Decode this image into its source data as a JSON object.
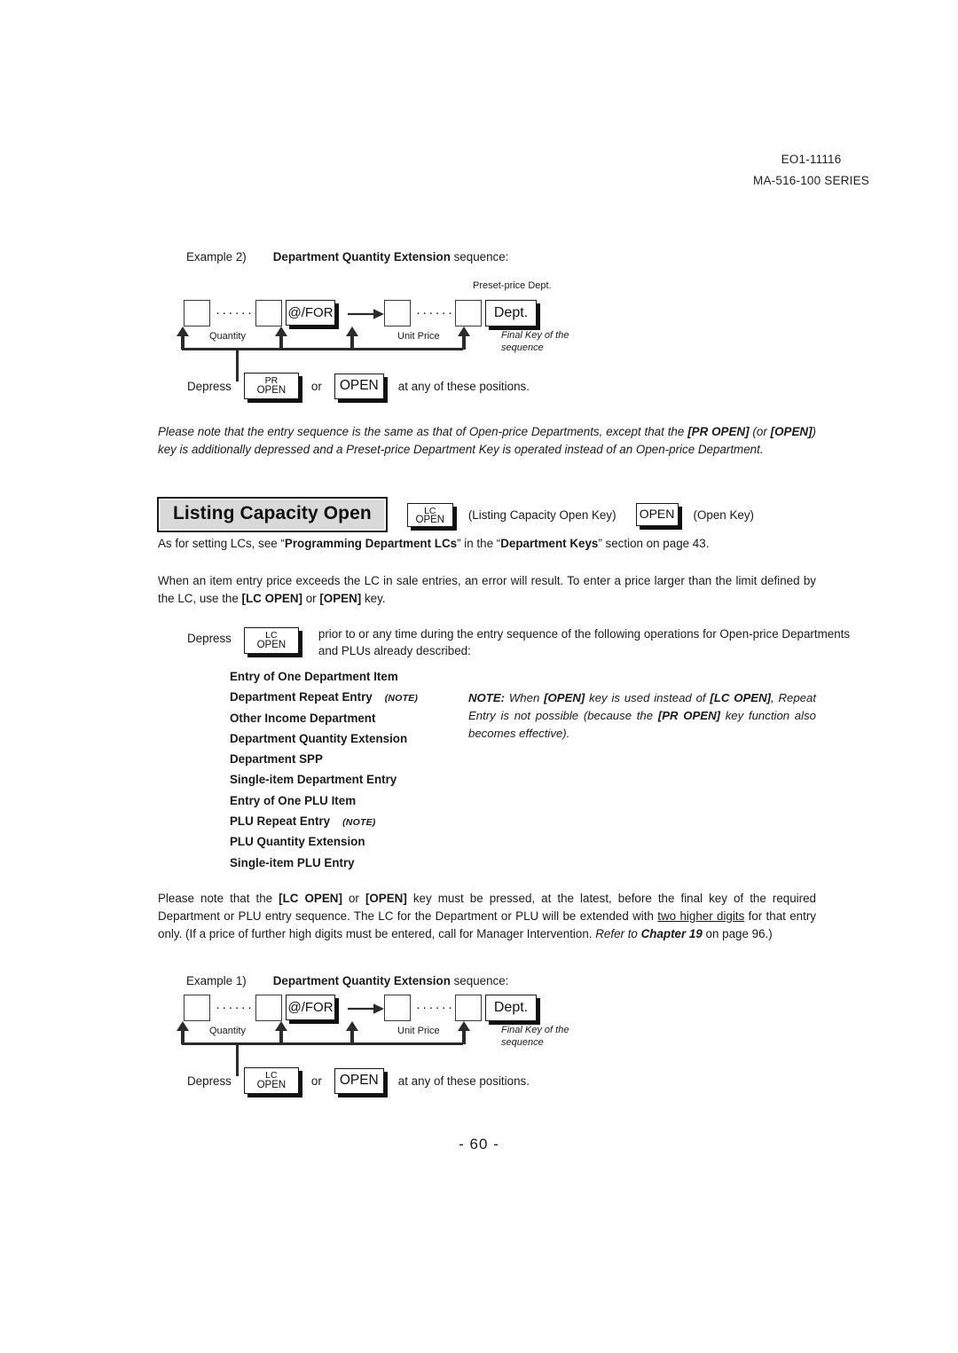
{
  "header": {
    "line1": "EO1-11116",
    "line2": "MA-516-100 SERIES"
  },
  "example2": {
    "label": "Example 2)",
    "title_bold": "Department Quantity Extension",
    "title_tail": " sequence:",
    "dots": "·······",
    "quantity_label": "Quantity",
    "unit_price_label": "Unit Price",
    "forfor_key": "@/FOR",
    "dept_key": "Dept.",
    "preset_label": "Preset-price Dept.",
    "final_key_line1": "Final Key of the",
    "final_key_line2": "sequence",
    "depress_word": "Depress",
    "key_pr_line1": "PR",
    "key_pr_line2": "OPEN",
    "or_word": "or",
    "key_open": "OPEN",
    "tail_text": "at any of these positions."
  },
  "note_paragraph": {
    "part1": "Please note that the entry sequence is the same as that of Open-price Departments, except that the ",
    "bold1": "[PR OPEN]",
    "part2": " (or ",
    "bold2": "[OPEN]",
    "part3": ") key is additionally depressed and a Preset-price Department Key is operated instead of an Open-price Department."
  },
  "section": {
    "heading": "Listing Capacity Open",
    "lc_key_line1": "LC",
    "lc_key_line2": "OPEN",
    "lc_caption": "(Listing Capacity Open Key)",
    "open_key": "OPEN",
    "open_caption": "(Open Key)"
  },
  "ref_line": {
    "part1": "As for setting LCs, see “",
    "bold1": "Programming Department LCs",
    "part2": "” in the “",
    "bold2": "Department Keys",
    "part3": "” section on page 43."
  },
  "lc_intro": {
    "part1": "When an item entry price exceeds the LC in sale entries, an error will result. To enter a price larger than the limit defined by the LC, use the ",
    "bold1": "[LC OPEN]",
    "part2": " or ",
    "bold2": "[OPEN]",
    "part3": " key."
  },
  "depress_lc": {
    "word": "Depress",
    "key_line1": "LC",
    "key_line2": "OPEN",
    "text_line1": "prior to or any time during the entry sequence of the following operations for Open-price",
    "text_line2": "Departments and PLUs already described:"
  },
  "operations": [
    {
      "label": "Entry of One Department Item",
      "note": ""
    },
    {
      "label": "Department Repeat Entry",
      "note": "(NOTE)"
    },
    {
      "label": "Other Income Department",
      "note": ""
    },
    {
      "label": "Department Quantity Extension",
      "note": ""
    },
    {
      "label": "Department SPP",
      "note": ""
    },
    {
      "label": "Single-item Department Entry",
      "note": ""
    },
    {
      "label": "Entry of One PLU Item",
      "note": ""
    },
    {
      "label": "PLU Repeat Entry",
      "note": "(NOTE)"
    },
    {
      "label": "PLU Quantity Extension",
      "note": ""
    },
    {
      "label": "Single-item PLU Entry",
      "note": ""
    }
  ],
  "note_box": {
    "lead": "NOTE:",
    "part1": " When ",
    "bold1": "[OPEN]",
    "part2": " key is used instead of ",
    "bold2": "[LC OPEN]",
    "part3": ", Repeat Entry is not possible (because the ",
    "bold3": "[PR OPEN]",
    "part4": " key function also becomes effective)."
  },
  "closing_paragraph": {
    "part1": "Please note that the ",
    "bold1": "[LC OPEN]",
    "part2": " or ",
    "bold2": "[OPEN]",
    "part3": " key must be pressed, at the latest, before the final key of the required Department or PLU entry sequence. The LC for the Department or PLU will be extended with ",
    "underline1": "two higher digits",
    "part4": " for that entry only. (If a price of further high digits must be entered, call for Manager Intervention. ",
    "italic1": "Refer to ",
    "italicbold1": "Chapter 19",
    "part5": " on page 96.)"
  },
  "example1": {
    "label": "Example 1)",
    "title_bold": "Department Quantity Extension",
    "title_tail": " sequence:",
    "dots": "·······",
    "quantity_label": "Quantity",
    "unit_price_label": "Unit Price",
    "forfor_key": "@/FOR",
    "dept_key": "Dept.",
    "final_key_line1": "Final Key of the",
    "final_key_line2": "sequence",
    "depress_word": "Depress",
    "key_lc_line1": "LC",
    "key_lc_line2": "OPEN",
    "or_word": "or",
    "key_open": "OPEN",
    "tail_text": "at any of these positions."
  },
  "footer": {
    "page_number": "- 60 -"
  }
}
